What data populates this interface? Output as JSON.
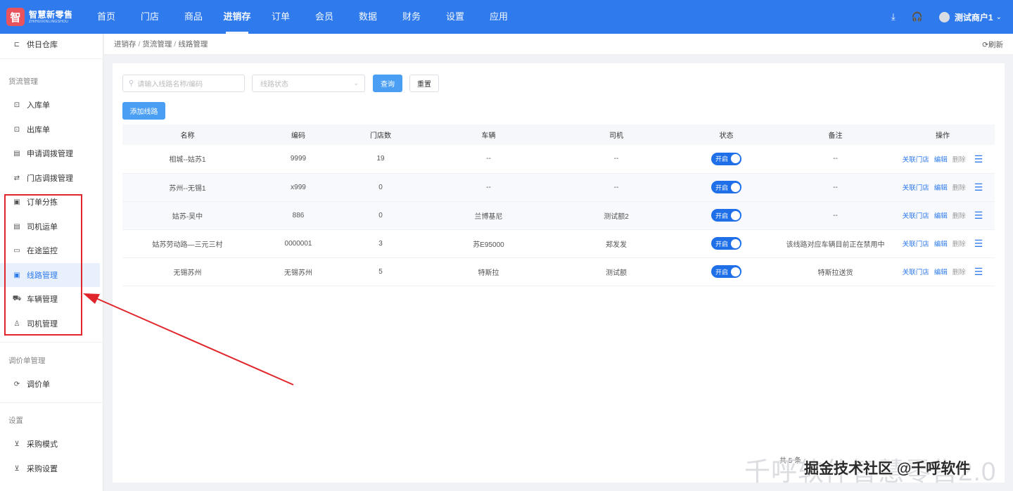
{
  "logo": {
    "mark": "智",
    "title": "智慧新零售",
    "subtitle": "ZHIHUIXINLINGSHOU"
  },
  "nav": {
    "items": [
      {
        "label": "首页"
      },
      {
        "label": "门店"
      },
      {
        "label": "商品"
      },
      {
        "label": "进销存"
      },
      {
        "label": "订单"
      },
      {
        "label": "会员"
      },
      {
        "label": "数据"
      },
      {
        "label": "财务"
      },
      {
        "label": "设置"
      },
      {
        "label": "应用"
      }
    ],
    "active": "进销存"
  },
  "topbar": {
    "user_name": "测试商户1",
    "download_icon": "⤓",
    "headset_icon": "🎧"
  },
  "sidebar": {
    "partial_item": "供日仓库",
    "groups": [
      {
        "label": "货流管理"
      },
      {
        "label": "调价单管理"
      },
      {
        "label": "设置"
      }
    ],
    "items": [
      {
        "label": "入库单",
        "icon": "inbound-icon",
        "glyph": "⊡"
      },
      {
        "label": "出库单",
        "icon": "outbound-icon",
        "glyph": "⊡"
      },
      {
        "label": "申请调拨管理",
        "icon": "chart-icon",
        "glyph": "▤"
      },
      {
        "label": "门店调拨管理",
        "icon": "transfer-icon",
        "glyph": "⇄"
      },
      {
        "label": "订单分拣",
        "icon": "image-icon",
        "glyph": "▣"
      },
      {
        "label": "司机运单",
        "icon": "document-icon",
        "glyph": "▤"
      },
      {
        "label": "在途监控",
        "icon": "video-icon",
        "glyph": "▭"
      },
      {
        "label": "线路管理",
        "icon": "route-icon",
        "glyph": "▣"
      },
      {
        "label": "车辆管理",
        "icon": "truck-icon",
        "glyph": "⛟"
      },
      {
        "label": "司机管理",
        "icon": "user-icon",
        "glyph": "♙"
      },
      {
        "label": "调价单",
        "icon": "refresh-icon",
        "glyph": "⟳"
      },
      {
        "label": "采购模式",
        "icon": "cart-icon",
        "glyph": "⊻"
      },
      {
        "label": "采购设置",
        "icon": "cart-icon",
        "glyph": "⊻"
      }
    ],
    "active_item": "线路管理"
  },
  "breadcrumb": {
    "items": [
      "进销存",
      "货流管理",
      "线路管理"
    ],
    "refresh_label": "刷新"
  },
  "filters": {
    "search_placeholder": "请输入线路名称/编码",
    "status_placeholder": "线路状态",
    "query_label": "查询",
    "reset_label": "重置",
    "add_label": "添加线路"
  },
  "table": {
    "columns": [
      "名称",
      "编码",
      "门店数",
      "车辆",
      "司机",
      "状态",
      "备注",
      "操作"
    ],
    "rows": [
      {
        "name": "相城--姑苏1",
        "code": "9999",
        "stores": "19",
        "vehicle": "--",
        "driver": "--",
        "status": "开启",
        "note": "--"
      },
      {
        "name": "苏州--无锡1",
        "code": "x999",
        "stores": "0",
        "vehicle": "--",
        "driver": "--",
        "status": "开启",
        "note": "--"
      },
      {
        "name": "姑苏-吴中",
        "code": "886",
        "stores": "0",
        "vehicle": "兰博基尼",
        "driver": "测试额2",
        "status": "开启",
        "note": "--"
      },
      {
        "name": "姑苏劳动路—三元三村",
        "code": "0000001",
        "stores": "3",
        "vehicle": "苏E95000",
        "driver": "郑发发",
        "status": "开启",
        "note": "该线路对应车辆目前正在禁用中"
      },
      {
        "name": "无锡苏州",
        "code": "无锡苏州",
        "stores": "5",
        "vehicle": "特斯拉",
        "driver": "测试额",
        "status": "开启",
        "note": "特斯拉送货"
      }
    ],
    "ops": {
      "link_stores": "关联门店",
      "edit": "编辑",
      "delete": "删除"
    }
  },
  "pager": {
    "text": "共 5 条"
  },
  "watermark": {
    "line1": "千呼软件智慧零售2.0",
    "line2": "掘金技术社区 @千呼软件"
  },
  "colors": {
    "primary": "#2f7bed",
    "annotation": "#e0262c"
  }
}
